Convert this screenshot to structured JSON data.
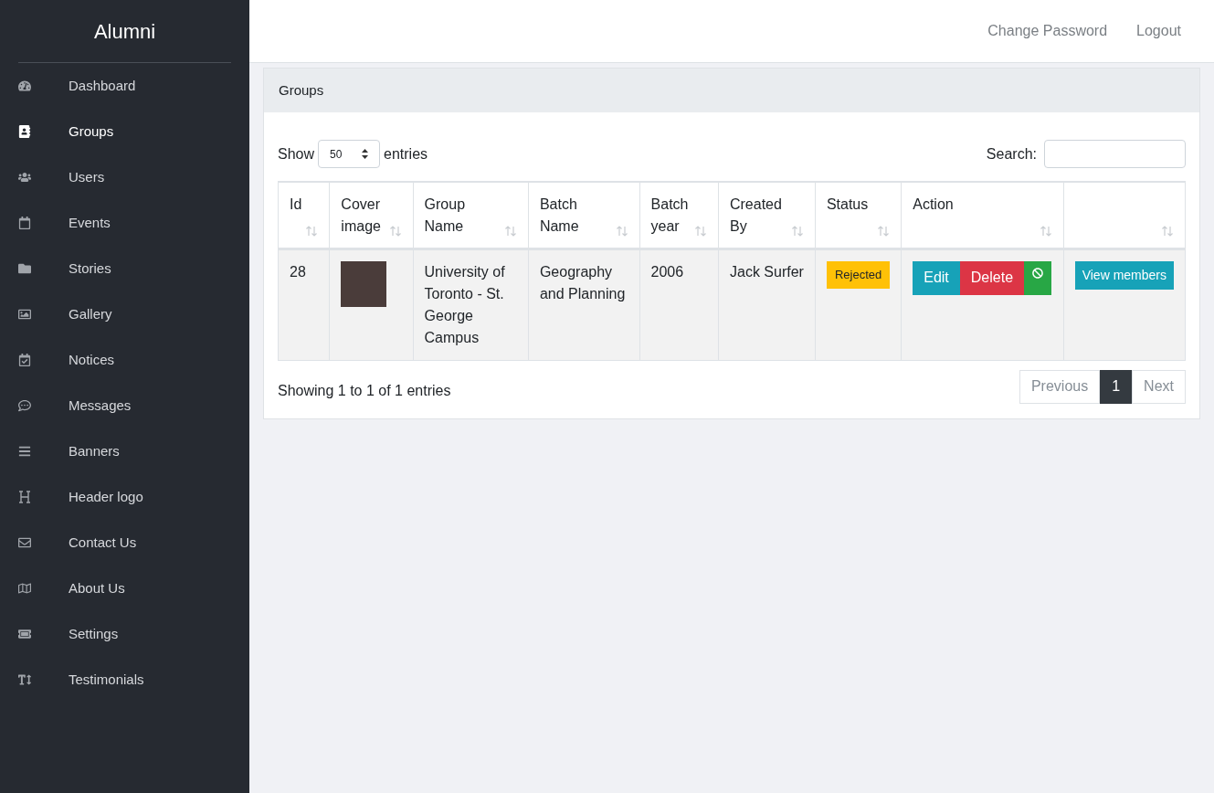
{
  "sidebar": {
    "title": "Alumni",
    "items": [
      {
        "label": "Dashboard",
        "selected": false
      },
      {
        "label": "Groups",
        "selected": true
      },
      {
        "label": "Users",
        "selected": false
      },
      {
        "label": "Events",
        "selected": false
      },
      {
        "label": "Stories",
        "selected": false
      },
      {
        "label": "Gallery",
        "selected": false
      },
      {
        "label": "Notices",
        "selected": false
      },
      {
        "label": "Messages",
        "selected": false
      },
      {
        "label": "Banners",
        "selected": false
      },
      {
        "label": "Header logo",
        "selected": false
      },
      {
        "label": "Contact Us",
        "selected": false
      },
      {
        "label": "About Us",
        "selected": false
      },
      {
        "label": "Settings",
        "selected": false
      },
      {
        "label": "Testimonials",
        "selected": false
      }
    ]
  },
  "topbar": {
    "links": [
      "Change Password",
      "Logout"
    ]
  },
  "card": {
    "title": "Groups",
    "length": {
      "before": "Show",
      "value": "50",
      "after": "entries"
    },
    "search": {
      "label": "Search:"
    },
    "table": {
      "columns": [
        [
          "Id"
        ],
        [
          "Cover",
          "image"
        ],
        [
          "Group Name"
        ],
        [
          "Batch",
          "Name"
        ],
        [
          "Batch",
          "year"
        ],
        [
          "Created",
          "By"
        ],
        [
          "Status"
        ],
        [
          "Action"
        ]
      ],
      "rows": [
        {
          "id": "28",
          "group_name": [
            "University of",
            "Toronto - St.",
            "George",
            "Campus"
          ],
          "batch_name": [
            "Geography",
            "and Planning"
          ],
          "batch_year": "2006",
          "created_by": "Jack Surfer",
          "status": {
            "text": "Rejected",
            "kind": "rejected"
          },
          "actions": [
            {
              "kind": "edit",
              "label": "Edit"
            },
            {
              "kind": "delete",
              "label": "Delete"
            },
            {
              "kind": "block"
            }
          ],
          "members_button": "View members"
        }
      ]
    },
    "info": "Showing 1 to 1 of 1 entries",
    "pagination": [
      {
        "label": "Previous",
        "selected": false
      },
      {
        "label": "1",
        "selected": true
      },
      {
        "label": "Next",
        "selected": false
      }
    ]
  }
}
